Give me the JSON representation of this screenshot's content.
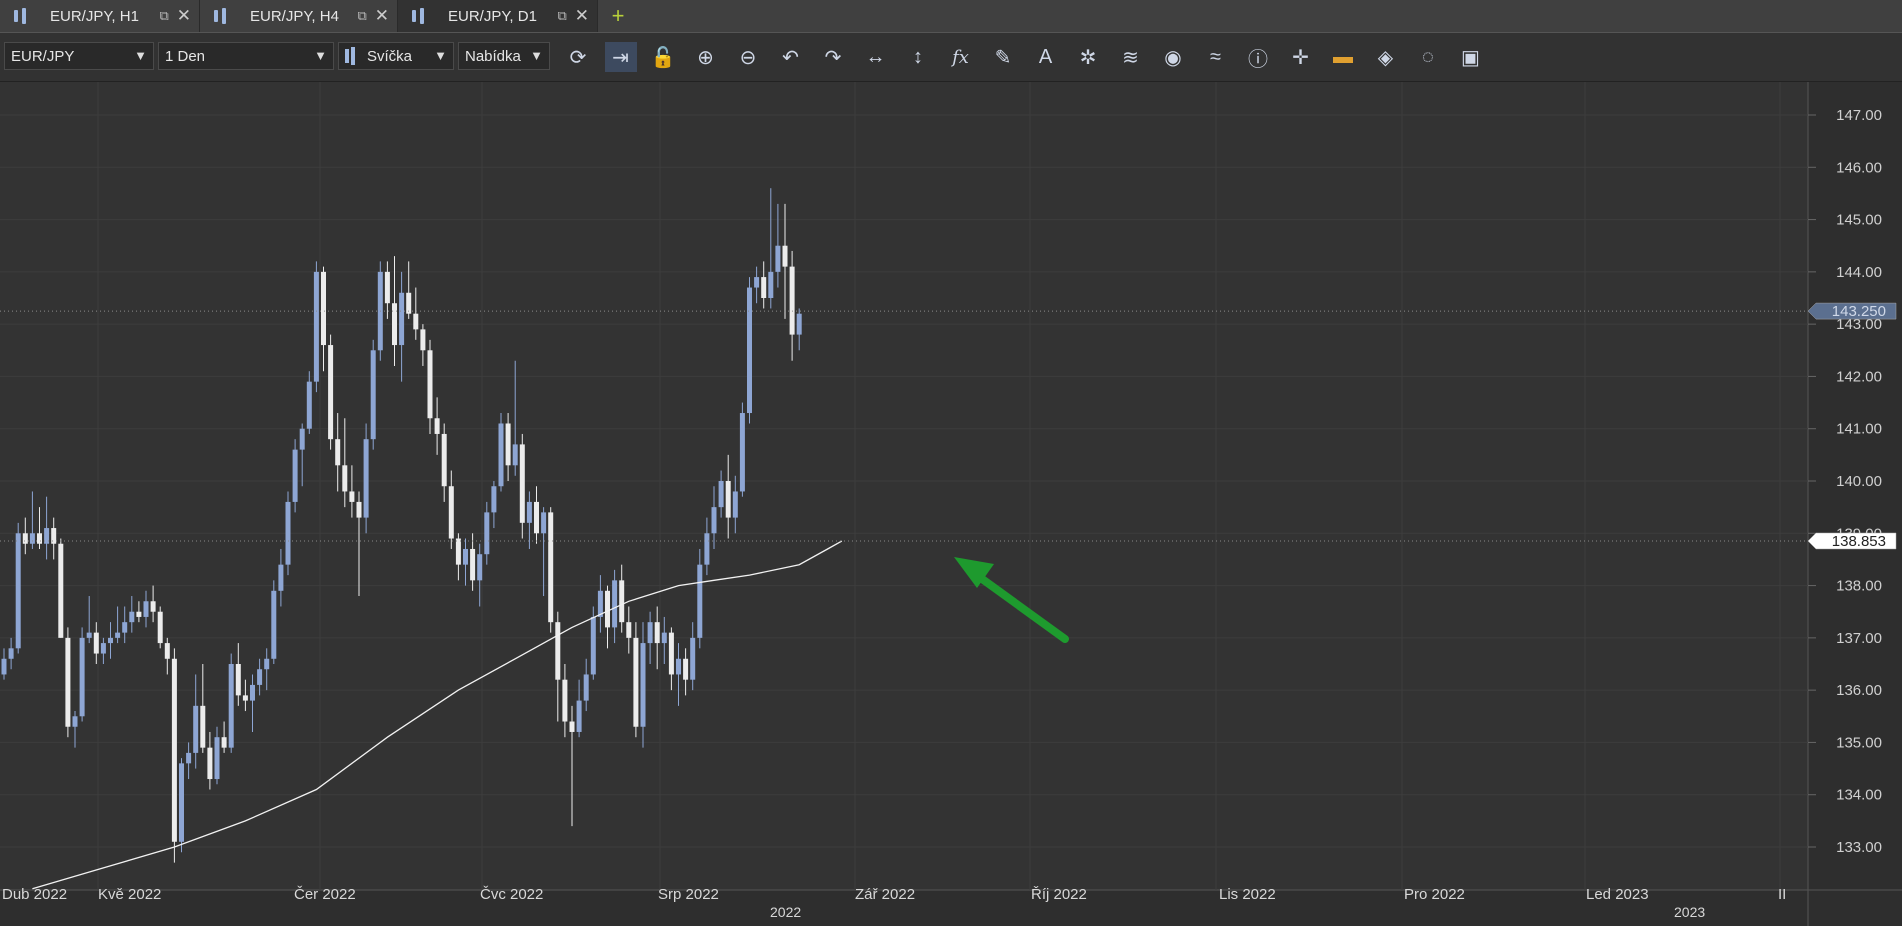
{
  "tabs": [
    {
      "label": "EUR/JPY, H1",
      "active": false
    },
    {
      "label": "EUR/JPY, H4",
      "active": false
    },
    {
      "label": "EUR/JPY, D1",
      "active": true
    }
  ],
  "toolbar": {
    "instrument": "EUR/JPY",
    "period": "1 Den",
    "chart_type": "Svíčka",
    "price_side": "Nabídka",
    "icons": [
      "refresh-icon",
      "shift-chart-icon",
      "unlock-icon",
      "zoom-in-icon",
      "zoom-out-icon",
      "undo-icon",
      "redo-icon",
      "horizontal-stretch-icon",
      "vertical-stretch-icon",
      "indicator-fx-icon",
      "pencil-icon",
      "text-tool-icon",
      "pattern-icon",
      "layers-icon",
      "eye-icon",
      "compare-icon",
      "info-icon",
      "crosshair-icon",
      "color-bar-icon",
      "paint-bucket-icon",
      "reset-icon",
      "save-icon"
    ]
  },
  "colors": {
    "background": "#333333",
    "bull_candle": "#8ea6d4",
    "bear_candle": "#ececec",
    "ma_line": "#f2f2f2",
    "arrow": "#1e9a2e",
    "current_price_label": "#5b6f8f"
  },
  "price_axis": {
    "labels": [
      "147.00",
      "146.00",
      "145.00",
      "144.00",
      "143.00",
      "142.00",
      "141.00",
      "140.00",
      "139.00",
      "138.00",
      "137.00",
      "136.00",
      "135.00",
      "134.00",
      "133.00"
    ],
    "current_price": "143.250",
    "ma_value": "138.853"
  },
  "time_axis": {
    "months": [
      "Dub 2022",
      "Kvě 2022",
      "Čer 2022",
      "Čvc 2022",
      "Srp 2022",
      "Zář 2022",
      "Říj 2022",
      "Lis 2022",
      "Pro 2022",
      "Led 2023",
      "II"
    ],
    "years": [
      "2022",
      "2023"
    ]
  },
  "chart_data": {
    "type": "candlestick",
    "symbol": "EUR/JPY",
    "timeframe": "1 Den",
    "ylim": [
      132.2,
      147.5
    ],
    "grid": true,
    "candles": [
      [
        136.3,
        136.8,
        136.2,
        136.6
      ],
      [
        136.6,
        137.0,
        136.4,
        136.8
      ],
      [
        136.8,
        139.2,
        136.7,
        139.0
      ],
      [
        139.0,
        139.3,
        138.6,
        138.8
      ],
      [
        138.8,
        139.8,
        138.7,
        139.0
      ],
      [
        139.0,
        139.5,
        138.7,
        138.8
      ],
      [
        138.8,
        139.7,
        138.5,
        139.1
      ],
      [
        139.1,
        139.3,
        138.5,
        138.8
      ],
      [
        138.8,
        138.9,
        137.0,
        137.0
      ],
      [
        137.0,
        137.2,
        135.1,
        135.3
      ],
      [
        135.3,
        135.6,
        134.9,
        135.5
      ],
      [
        135.5,
        137.2,
        135.4,
        137.0
      ],
      [
        137.0,
        137.8,
        136.9,
        137.1
      ],
      [
        137.1,
        137.3,
        136.5,
        136.7
      ],
      [
        136.7,
        137.0,
        136.5,
        136.9
      ],
      [
        136.9,
        137.3,
        136.6,
        137.0
      ],
      [
        137.0,
        137.6,
        136.9,
        137.1
      ],
      [
        137.1,
        137.6,
        136.9,
        137.3
      ],
      [
        137.3,
        137.8,
        137.1,
        137.5
      ],
      [
        137.5,
        137.7,
        137.3,
        137.4
      ],
      [
        137.4,
        137.9,
        137.2,
        137.7
      ],
      [
        137.7,
        138.0,
        137.3,
        137.5
      ],
      [
        137.5,
        137.6,
        136.8,
        136.9
      ],
      [
        136.9,
        137.0,
        136.3,
        136.6
      ],
      [
        136.6,
        136.8,
        132.7,
        133.1
      ],
      [
        133.1,
        134.7,
        132.9,
        134.6
      ],
      [
        134.6,
        135.0,
        134.3,
        134.8
      ],
      [
        134.8,
        136.3,
        134.5,
        135.7
      ],
      [
        135.7,
        136.5,
        134.8,
        134.9
      ],
      [
        134.9,
        135.2,
        134.1,
        134.3
      ],
      [
        134.3,
        135.3,
        134.2,
        135.1
      ],
      [
        135.1,
        135.4,
        134.8,
        134.9
      ],
      [
        134.9,
        136.7,
        134.8,
        136.5
      ],
      [
        136.5,
        136.9,
        135.7,
        135.9
      ],
      [
        135.9,
        136.2,
        135.6,
        135.8
      ],
      [
        135.8,
        136.3,
        135.2,
        136.1
      ],
      [
        136.1,
        136.6,
        135.9,
        136.4
      ],
      [
        136.4,
        136.8,
        136.0,
        136.6
      ],
      [
        136.6,
        138.1,
        136.5,
        137.9
      ],
      [
        137.9,
        138.7,
        137.6,
        138.4
      ],
      [
        138.4,
        139.8,
        138.2,
        139.6
      ],
      [
        139.6,
        140.8,
        139.4,
        140.6
      ],
      [
        140.6,
        141.1,
        139.9,
        141.0
      ],
      [
        141.0,
        142.1,
        140.9,
        141.9
      ],
      [
        141.9,
        144.2,
        141.7,
        144.0
      ],
      [
        144.0,
        144.1,
        142.1,
        142.6
      ],
      [
        142.6,
        142.8,
        140.6,
        140.8
      ],
      [
        140.8,
        141.3,
        139.8,
        140.3
      ],
      [
        140.3,
        141.2,
        139.5,
        139.8
      ],
      [
        139.8,
        140.3,
        139.3,
        139.6
      ],
      [
        139.6,
        139.8,
        137.8,
        139.3
      ],
      [
        139.3,
        141.1,
        139.0,
        140.8
      ],
      [
        140.8,
        142.7,
        140.6,
        142.5
      ],
      [
        142.5,
        144.2,
        142.3,
        144.0
      ],
      [
        144.0,
        144.2,
        143.1,
        143.4
      ],
      [
        143.4,
        144.3,
        142.2,
        142.6
      ],
      [
        142.6,
        144.0,
        141.9,
        143.6
      ],
      [
        143.6,
        144.2,
        143.1,
        143.2
      ],
      [
        143.2,
        143.7,
        142.7,
        142.9
      ],
      [
        142.9,
        143.0,
        142.2,
        142.5
      ],
      [
        142.5,
        142.7,
        140.9,
        141.2
      ],
      [
        141.2,
        141.6,
        140.5,
        140.9
      ],
      [
        140.9,
        141.1,
        139.6,
        139.9
      ],
      [
        139.9,
        140.2,
        138.7,
        138.9
      ],
      [
        138.9,
        139.0,
        138.1,
        138.4
      ],
      [
        138.4,
        138.9,
        138.0,
        138.7
      ],
      [
        138.7,
        139.0,
        137.9,
        138.1
      ],
      [
        138.1,
        138.8,
        137.6,
        138.6
      ],
      [
        138.6,
        139.6,
        138.4,
        139.4
      ],
      [
        139.4,
        140.0,
        139.1,
        139.9
      ],
      [
        139.9,
        141.3,
        139.8,
        141.1
      ],
      [
        141.1,
        141.3,
        140.0,
        140.3
      ],
      [
        140.3,
        142.3,
        140.1,
        140.7
      ],
      [
        140.7,
        140.9,
        138.9,
        139.2
      ],
      [
        139.2,
        139.8,
        138.7,
        139.6
      ],
      [
        139.6,
        139.9,
        138.8,
        139.0
      ],
      [
        139.0,
        139.5,
        137.8,
        139.4
      ],
      [
        139.4,
        139.5,
        137.1,
        137.3
      ],
      [
        137.3,
        137.5,
        135.4,
        136.2
      ],
      [
        136.2,
        136.5,
        135.1,
        135.4
      ],
      [
        135.4,
        135.7,
        133.4,
        135.2
      ],
      [
        135.2,
        136.2,
        135.1,
        135.8
      ],
      [
        135.8,
        136.6,
        135.6,
        136.3
      ],
      [
        136.3,
        137.6,
        136.2,
        137.4
      ],
      [
        137.4,
        138.2,
        137.1,
        137.9
      ],
      [
        137.9,
        138.0,
        136.8,
        137.2
      ],
      [
        137.2,
        138.3,
        136.9,
        138.1
      ],
      [
        138.1,
        138.4,
        137.1,
        137.3
      ],
      [
        137.3,
        137.6,
        136.7,
        137.0
      ],
      [
        137.0,
        137.3,
        135.1,
        135.3
      ],
      [
        135.3,
        137.3,
        134.9,
        136.9
      ],
      [
        136.9,
        137.5,
        136.5,
        137.3
      ],
      [
        137.3,
        137.6,
        136.4,
        136.9
      ],
      [
        136.9,
        137.4,
        136.5,
        137.1
      ],
      [
        137.1,
        137.2,
        136.0,
        136.3
      ],
      [
        136.3,
        136.9,
        135.7,
        136.6
      ],
      [
        136.6,
        136.8,
        135.9,
        136.2
      ],
      [
        136.2,
        137.3,
        136.0,
        137.0
      ],
      [
        137.0,
        138.7,
        136.8,
        138.4
      ],
      [
        138.4,
        139.3,
        138.2,
        139.0
      ],
      [
        139.0,
        139.9,
        138.7,
        139.5
      ],
      [
        139.5,
        140.2,
        139.3,
        140.0
      ],
      [
        140.0,
        140.5,
        138.9,
        139.3
      ],
      [
        139.3,
        140.1,
        139.0,
        139.8
      ],
      [
        139.8,
        141.5,
        139.7,
        141.3
      ],
      [
        141.3,
        143.9,
        141.1,
        143.7
      ],
      [
        143.7,
        144.1,
        143.4,
        143.9
      ],
      [
        143.9,
        144.2,
        143.3,
        143.5
      ],
      [
        143.5,
        145.6,
        143.3,
        144.0
      ],
      [
        144.0,
        145.3,
        143.7,
        144.5
      ],
      [
        144.5,
        145.3,
        143.1,
        144.1
      ],
      [
        144.1,
        144.4,
        142.3,
        142.8
      ],
      [
        142.8,
        143.3,
        142.5,
        143.2
      ]
    ],
    "moving_average": [
      [
        4,
        132.2
      ],
      [
        14,
        132.6
      ],
      [
        24,
        133.0
      ],
      [
        34,
        133.5
      ],
      [
        44,
        134.1
      ],
      [
        54,
        135.1
      ],
      [
        64,
        136.0
      ],
      [
        72,
        136.6
      ],
      [
        80,
        137.2
      ],
      [
        88,
        137.7
      ],
      [
        95,
        138.0
      ],
      [
        100,
        138.1
      ],
      [
        105,
        138.2
      ],
      [
        112,
        138.4
      ],
      [
        116,
        138.7
      ],
      [
        118,
        138.85
      ]
    ]
  }
}
